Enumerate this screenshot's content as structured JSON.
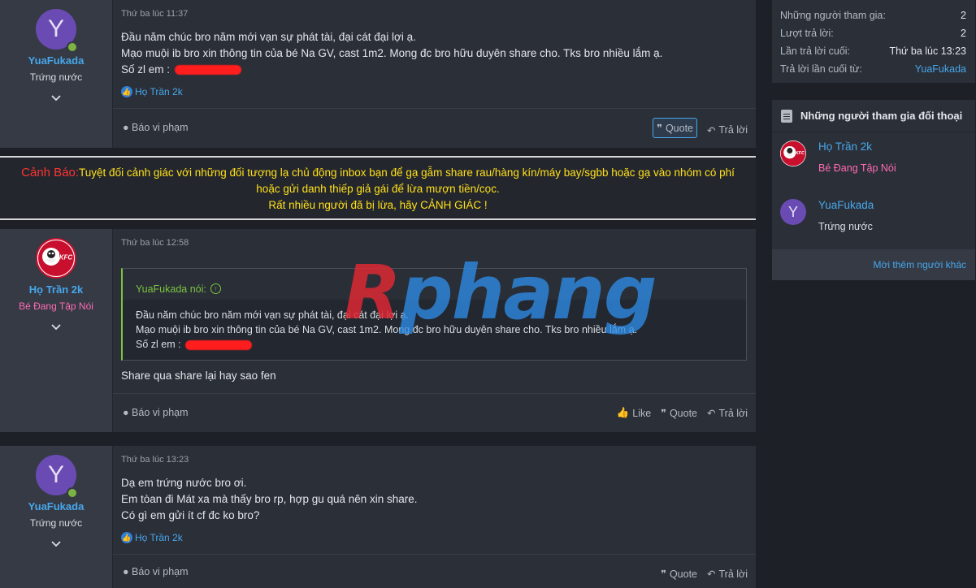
{
  "posts": [
    {
      "time": "Thứ ba lúc 11:37",
      "user": {
        "name": "YuaFukada",
        "title": "Trứng nước",
        "avatar_letter": "Y"
      },
      "lines": [
        "Đầu năm chúc bro năm mới vạn sự phát tài, đại cát đại lợi ạ.",
        "Mạo muội ib bro xin thông tin của bé Na GV, cast 1m2. Mong đc bro hữu duyên share cho. Tks bro nhiều lắm ạ.",
        "Số zl em :"
      ],
      "likes": "Họ Trần 2k",
      "report": "Báo vi phạm",
      "quote": "Quote",
      "reply": "Trả lời"
    },
    {
      "time": "Thứ ba lúc 12:58",
      "user": {
        "name": "Họ Trần 2k",
        "title": "Bé Đang Tập Nói",
        "avatar_letter": "KFC"
      },
      "quote_block": {
        "author": "YuaFukada nói:",
        "lines": [
          "Đầu năm chúc bro năm mới vạn sự phát tài, đại cát đại lợi ạ.",
          "Mạo muội ib bro xin thông tin của bé Na GV, cast 1m2. Mong đc bro hữu duyên share cho. Tks bro nhiều lắm ạ.",
          "Số zl em :"
        ]
      },
      "text": "Share qua share lại hay sao fen",
      "report": "Báo vi phạm",
      "like": "Like",
      "quote": "Quote",
      "reply": "Trả lời"
    },
    {
      "time": "Thứ ba lúc 13:23",
      "user": {
        "name": "YuaFukada",
        "title": "Trứng nước",
        "avatar_letter": "Y"
      },
      "lines": [
        "Dạ em trứng nước bro ơi.",
        "Em tòan đi Mát xa mà thấy bro rp, hợp gu quá nên xin share.",
        "Có gì em gửi ít cf đc ko bro?"
      ],
      "likes": "Họ Trần 2k",
      "report": "Báo vi phạm",
      "quote": "Quote",
      "reply": "Trả lời"
    }
  ],
  "warning": {
    "label": "Cảnh Báo:",
    "line1": "Tuyệt đối cảnh giác với những đối tượng lạ chủ động inbox bạn để gạ gẫm share rau/hàng kín/máy bay/sgbb hoặc gạ vào nhóm có phí",
    "line2": "hoặc gửi danh thiếp giả gái để lừa mượn tiền/cọc.",
    "line3": "Rất nhiều người đã bị lừa, hãy CẢNH GIÁC !"
  },
  "watermark": {
    "first": "R",
    "rest": "phang"
  },
  "thread_info": {
    "participants_label": "Những người tham gia:",
    "participants_value": "2",
    "replies_label": "Lượt trả lời:",
    "replies_value": "2",
    "last_reply_label": "Lần trả lời cuối:",
    "last_reply_value": "Thứ ba lúc 13:23",
    "last_from_label": "Trả lời lần cuối từ:",
    "last_from_value": "YuaFukada"
  },
  "participants": {
    "heading": "Những người tham gia đối thoại",
    "people": [
      {
        "name": "Họ Trần 2k",
        "title": "Bé Đang Tập Nói"
      },
      {
        "name": "YuaFukada",
        "title": "Trứng nước",
        "avatar_letter": "Y"
      }
    ],
    "invite": "Mời thêm người khác"
  },
  "colors": {
    "link": "#47a7eb",
    "pink_title": "#ff6cb4",
    "quote_green": "#7cc43e",
    "warning_red": "#ff3333",
    "warning_yellow": "#ffe019"
  }
}
